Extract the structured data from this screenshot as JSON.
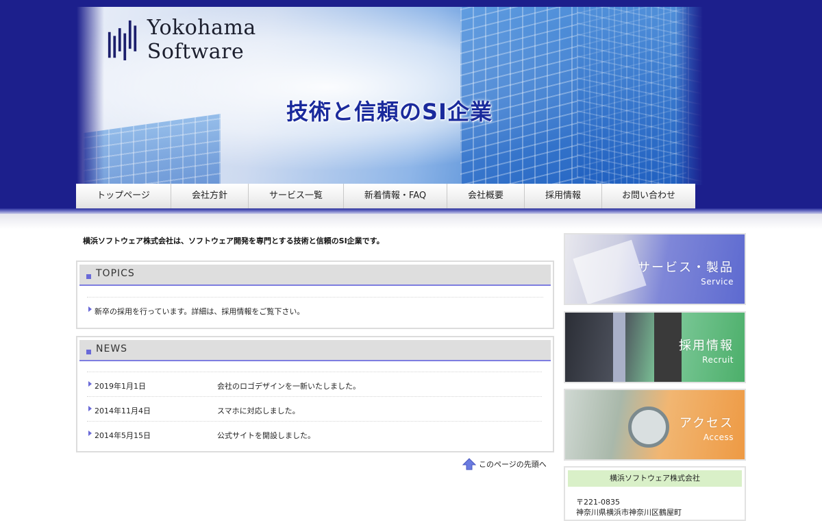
{
  "header": {
    "logo_text": "Yokohama Software",
    "tagline": "技術と信頼のSI企業"
  },
  "nav": {
    "items": [
      {
        "label": "トップページ"
      },
      {
        "label": "会社方針"
      },
      {
        "label": "サービス一覧"
      },
      {
        "label": "新着情報・FAQ"
      },
      {
        "label": "会社概要"
      },
      {
        "label": "採用情報"
      },
      {
        "label": "お問い合わせ"
      }
    ]
  },
  "main": {
    "intro": "横浜ソフトウェア株式会社は、ソフトウェア開発を専門とする技術と信頼のSI企業です。",
    "topics": {
      "title": "TOPICS",
      "items": [
        "新卒の採用を行っています。詳細は、採用情報をご覧下さい。"
      ]
    },
    "news": {
      "title": "NEWS",
      "items": [
        {
          "date": "2019年1月1日",
          "text": "会社のロゴデザインを一新いたしました。"
        },
        {
          "date": "2014年11月4日",
          "text": "スマホに対応しました。"
        },
        {
          "date": "2014年5月15日",
          "text": "公式サイトを開設しました。"
        }
      ]
    },
    "page_top": "このページの先頭へ"
  },
  "sidebar": {
    "banners": [
      {
        "jp": "サービス・製品",
        "en": "Service"
      },
      {
        "jp": "採用情報",
        "en": "Recruit"
      },
      {
        "jp": "アクセス",
        "en": "Access"
      }
    ],
    "company": {
      "name": "横浜ソフトウェア株式会社",
      "zip": "〒221-0835",
      "address": "神奈川県横浜市神奈川区鶴屋町"
    }
  },
  "colors": {
    "band": "#1c1f8c",
    "accent": "#6a6ad8",
    "tagline": "#1a2a9c",
    "company_head": "#d9f0c8"
  }
}
